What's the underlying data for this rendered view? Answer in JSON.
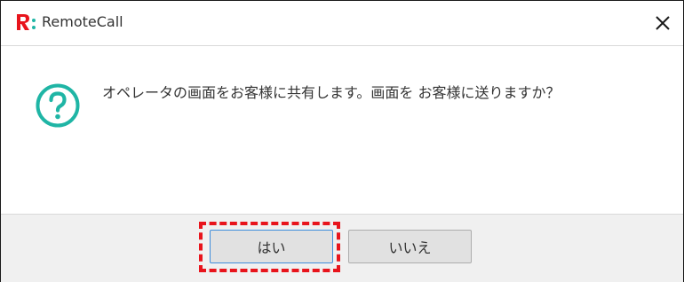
{
  "window": {
    "title": "RemoteCall",
    "logo_icon": "remotecall-logo",
    "close_icon": "close-icon",
    "close_glyph": "✕"
  },
  "dialog": {
    "icon": "question-icon",
    "icon_color": "#1fb5a5",
    "message": "オペレータの画面をお客様に共有します。画面を お客様に送りますか？"
  },
  "buttons": {
    "yes_label": "はい",
    "no_label": "いいえ"
  },
  "colors": {
    "accent": "#e8141c",
    "focus_border": "#3e8ddb"
  }
}
